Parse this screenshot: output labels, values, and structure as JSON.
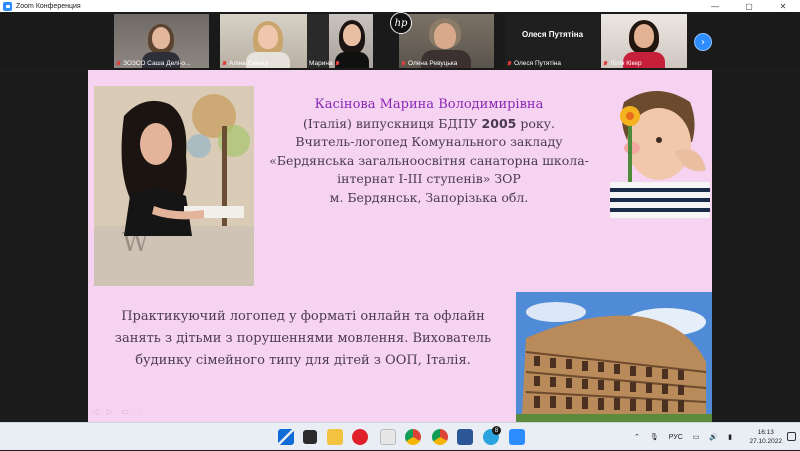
{
  "window": {
    "title": "Zoom Конференция"
  },
  "participants": [
    {
      "label": "ЗОЗСО Саша Делі-о...",
      "muted": true
    },
    {
      "label": "Аліна Синиці",
      "muted": true
    },
    {
      "label": "Марина",
      "muted": true
    },
    {
      "label": "Олена Ревуцька",
      "muted": true
    },
    {
      "label": "Олеся Путятіна",
      "muted": true,
      "name_display": "Олеся Путятіна"
    },
    {
      "label": "Лілія Кікер",
      "muted": true
    }
  ],
  "slide": {
    "name": "Касінова Марина Володимирівна",
    "line1_pre": "(Італія) випускниця БДПУ ",
    "line1_year": "2005",
    "line1_post": " року.",
    "line2": "Вчитель-логопед Комунального закладу",
    "line3": "«Бердянська загальноосвітня санаторна школа-",
    "line4": "інтернат І-ІІІ ступенів» ЗОР",
    "line5": "м. Бердянськ, Запорізька обл.",
    "lower1": "Практикуючий логопед у форматі онлайн та офлайн",
    "lower2": "занять з дітьми з порушеннями мовлення. Вихователь",
    "lower3": "будинку сімейного типу для дітей з ООП, Італія."
  },
  "taskbar": {
    "language": "РУС",
    "time": "16:13",
    "date": "27.10.2022",
    "telegram_badge": "8"
  },
  "colors": {
    "slide_bg": "#f6d3f1",
    "name_color": "#8b27b5",
    "zoom_blue": "#2d8cff"
  }
}
